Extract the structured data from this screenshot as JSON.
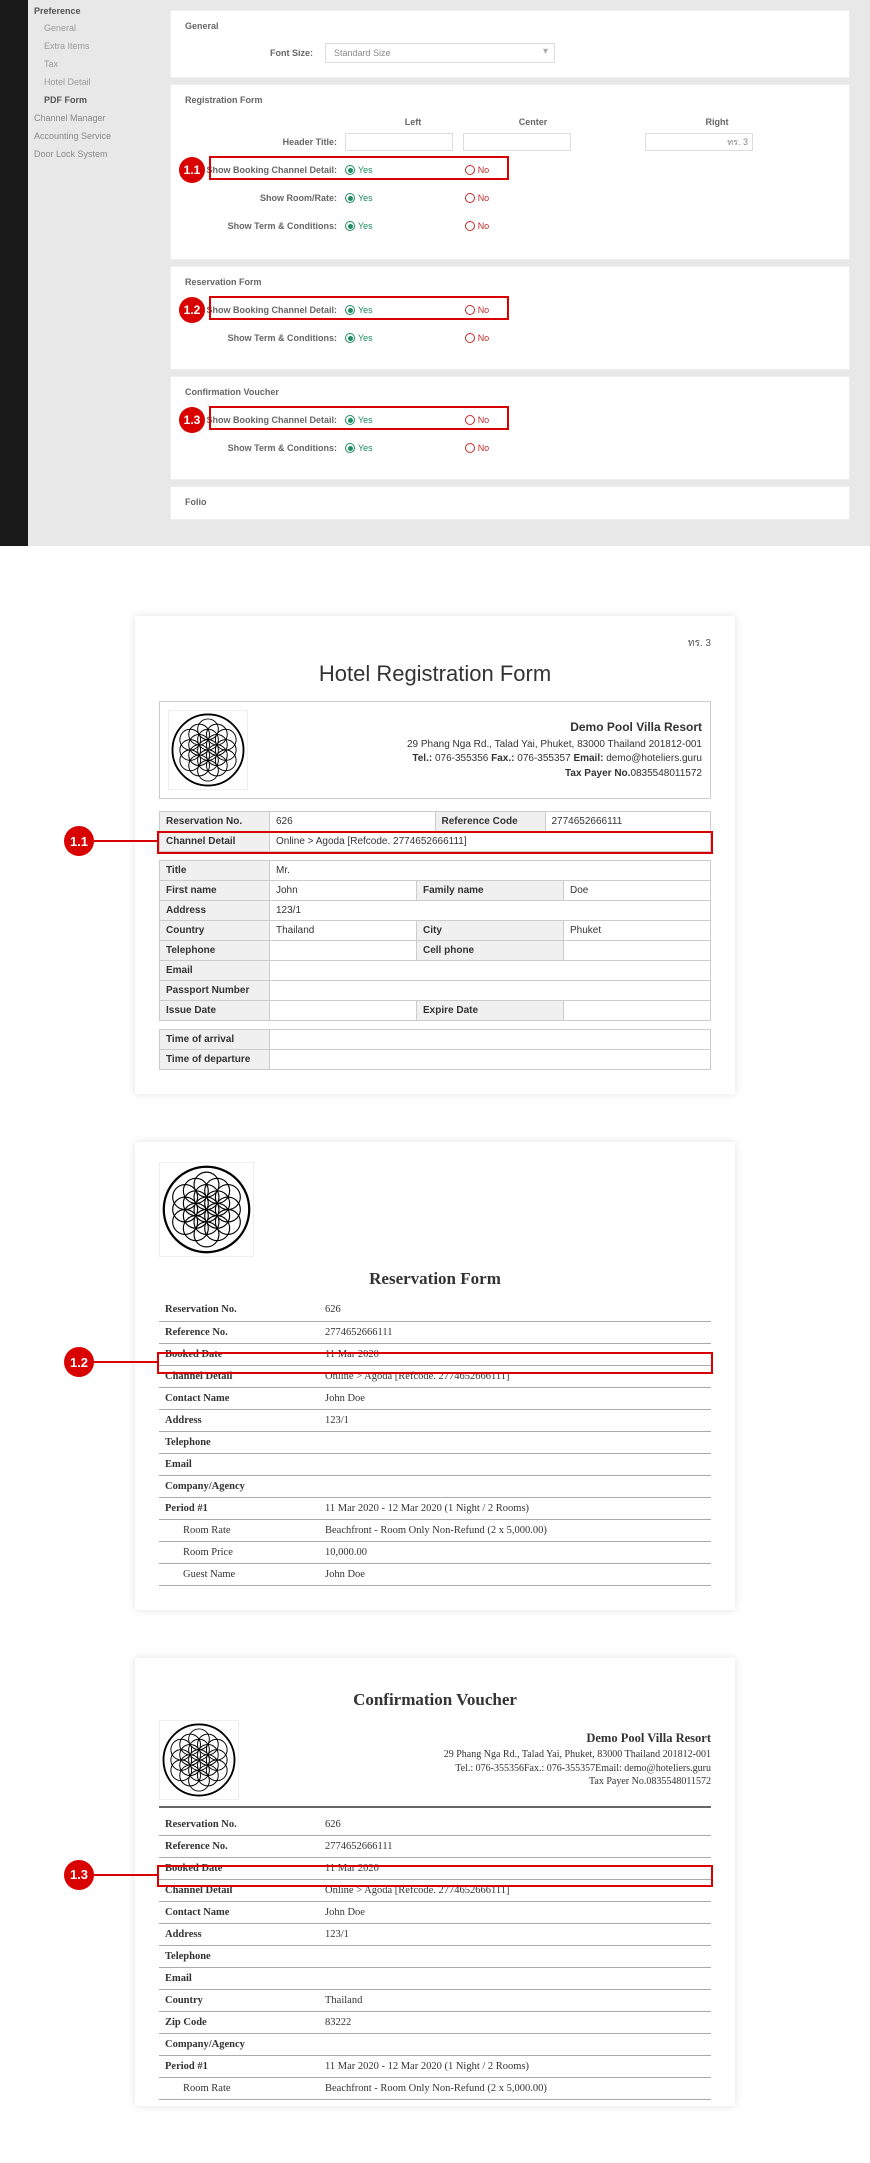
{
  "sidebar": {
    "title": "Preference",
    "items": [
      {
        "label": "General",
        "level": 2
      },
      {
        "label": "Extra Items",
        "level": 2
      },
      {
        "label": "Tax",
        "level": 2
      },
      {
        "label": "Hotel Detail",
        "level": 2
      },
      {
        "label": "PDF Form",
        "level": 2,
        "active": true
      },
      {
        "label": "Channel Manager",
        "level": 1
      },
      {
        "label": "Accounting Service",
        "level": 1
      },
      {
        "label": "Door Lock System",
        "level": 1
      }
    ]
  },
  "settings": {
    "general": {
      "title": "General",
      "font_size_label": "Font Size:",
      "font_size_value": "Standard Size"
    },
    "col_left": "Left",
    "col_center": "Center",
    "col_right": "Right",
    "header_title_label": "Header Title:",
    "header_right_value": "ทร. 3",
    "opt_yes": "Yes",
    "opt_no": "No",
    "registration": {
      "title": "Registration Form",
      "show_channel": "Show Booking Channel Detail:",
      "show_rate": "Show Room/Rate:",
      "show_terms": "Show Term & Conditions:",
      "badge": "1.1"
    },
    "reservation": {
      "title": "Reservation Form",
      "show_channel": "Show Booking Channel Detail:",
      "show_terms": "Show Term & Conditions:",
      "badge": "1.2"
    },
    "confirmation": {
      "title": "Confirmation Voucher",
      "show_channel": "Show Booking Channel Detail:",
      "show_terms": "Show Term & Conditions:",
      "badge": "1.3"
    },
    "folio_title": "Folio"
  },
  "hotel": {
    "name": "Demo Pool Villa Resort",
    "address": "29 Phang Nga Rd., Talad Yai, Phuket, 83000 Thailand 201812-001",
    "tel_label": "Tel.:",
    "tel": "076-355356",
    "fax_label": "Fax.:",
    "fax": "076-355357",
    "email_label": "Email:",
    "email": "demo@hoteliers.guru",
    "taxpayer_label": "Tax Payer No.",
    "taxpayer": "0835548011572"
  },
  "doc_reg": {
    "top_code": "ทร. 3",
    "title": "Hotel Registration Form",
    "badge": "1.1",
    "rows": {
      "res_no_l": "Reservation No.",
      "res_no": "626",
      "ref_l": "Reference Code",
      "ref": "2774652666111",
      "channel_l": "Channel Detail",
      "channel": "Online > Agoda [Refcode. 2774652666111]",
      "title_l": "Title",
      "title_v": "Mr.",
      "fname_l": "First name",
      "fname": "John",
      "lname_l": "Family name",
      "lname": "Doe",
      "addr_l": "Address",
      "addr": "123/1",
      "country_l": "Country",
      "country": "Thailand",
      "city_l": "City",
      "city": "Phuket",
      "tel_l": "Telephone",
      "cell_l": "Cell phone",
      "email_l": "Email",
      "passport_l": "Passport Number",
      "issue_l": "Issue Date",
      "expire_l": "Expire Date",
      "arr_l": "Time of arrival",
      "dep_l": "Time of departure"
    }
  },
  "doc_res": {
    "title": "Reservation Form",
    "badge": "1.2",
    "rows": {
      "res_no_l": "Reservation No.",
      "res_no": "626",
      "ref_l": "Reference No.",
      "ref": "2774652666111",
      "booked_l": "Booked Date",
      "booked": "11 Mar 2020",
      "channel_l": "Channel Detail",
      "channel": "Online > Agoda [Refcode. 2774652666111]",
      "contact_l": "Contact Name",
      "contact": "John Doe",
      "addr_l": "Address",
      "addr": "123/1",
      "tel_l": "Telephone",
      "email_l": "Email",
      "agency_l": "Company/Agency",
      "period_l": "Period #1",
      "period": "11 Mar 2020 - 12 Mar 2020 (1 Night / 2 Rooms)",
      "rate_l": "Room Rate",
      "rate": "Beachfront - Room Only Non-Refund (2 x 5,000.00)",
      "price_l": "Room Price",
      "price": "10,000.00",
      "guest_l": "Guest Name",
      "guest": "John Doe"
    }
  },
  "doc_conf": {
    "title": "Confirmation Voucher",
    "badge": "1.3",
    "rows": {
      "res_no_l": "Reservation No.",
      "res_no": "626",
      "ref_l": "Reference No.",
      "ref": "2774652666111",
      "booked_l": "Booked Date",
      "booked": "11 Mar 2020",
      "channel_l": "Channel Detail",
      "channel": "Online > Agoda [Refcode. 2774652666111]",
      "contact_l": "Contact Name",
      "contact": "John Doe",
      "addr_l": "Address",
      "addr": "123/1",
      "tel_l": "Telephone",
      "email_l": "Email",
      "country_l": "Country",
      "country": "Thailand",
      "zip_l": "Zip Code",
      "zip": "83222",
      "agency_l": "Company/Agency",
      "period_l": "Period #1",
      "period": "11 Mar 2020 - 12 Mar 2020 (1 Night / 2 Rooms)",
      "rate_l": "Room Rate",
      "rate": "Beachfront - Room Only Non-Refund (2 x 5,000.00)"
    }
  }
}
